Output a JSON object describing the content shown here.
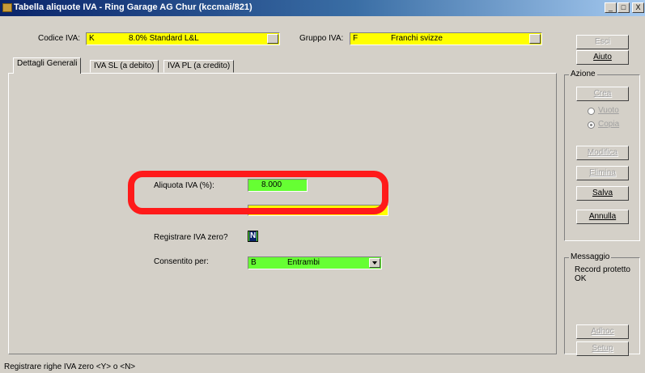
{
  "window": {
    "title": "Tabella aliquote IVA - Ring Garage AG Chur (kccmai/821)",
    "controls": [
      "_",
      "□",
      "X"
    ]
  },
  "header": {
    "codice_label": "Codice IVA:",
    "codice_code": "K",
    "codice_desc": "8.0% Standard L&L",
    "gruppo_label": "Gruppo IVA:",
    "gruppo_code": "F",
    "gruppo_desc": "Franchi svizze"
  },
  "tabs": [
    {
      "label": "Dettagli Generali"
    },
    {
      "label": "IVA SL (a debito)"
    },
    {
      "label": "IVA PL (a credito)"
    }
  ],
  "form": {
    "aliquota_label": "Aliquota IVA (%):",
    "aliquota_value": "8.000",
    "registrare_label": "Registrare IVA zero?",
    "registrare_value": "N",
    "consentito_label": "Consentito per:",
    "consentito_code": "B",
    "consentito_value": "Entrambi"
  },
  "side": {
    "esci": "Esci",
    "aiuto": "Aiuto",
    "azione_label": "Azione",
    "crea": "Crea",
    "vuoto": "Vuoto",
    "copia": "Copia",
    "modifica": "Modifica",
    "elimina": "Elimina",
    "salva": "Salva",
    "annulla": "Annulla",
    "messaggio_label": "Messaggio",
    "messaggio_text": "Record protetto OK",
    "adhoc": "Adhoc",
    "setup": "Setup"
  },
  "status": {
    "text": "Registrare righe IVA zero <Y> o <N>"
  },
  "colors": {
    "required_field": "#ffff00",
    "editable_field": "#66ff33",
    "highlight": "#ff1a1a"
  }
}
